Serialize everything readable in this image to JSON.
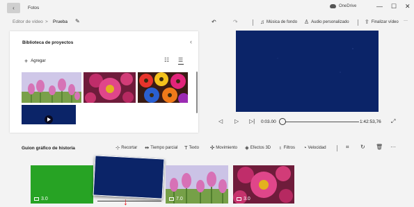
{
  "window": {
    "app_title": "Fotos",
    "back_icon": "back-arrow-icon",
    "onedrive_label": "OneDrive",
    "controls": [
      "—",
      "☐",
      "✕"
    ]
  },
  "breadcrumb": {
    "editor": "Editor de vídeo",
    "separator": ">",
    "project": "Prueba",
    "edit_icon": "pencil-icon"
  },
  "toolbar": {
    "undo": "↶",
    "redo": "↷",
    "background_music": "Música de fondo",
    "custom_audio": "Audio personalizado",
    "finish_video": "Finalizar vídeo",
    "more": "···"
  },
  "library": {
    "title": "Biblioteca de proyectos",
    "add_label": "Agregar",
    "thumbnails": [
      "tulips",
      "pink-gerbera",
      "colorful-gerberas",
      "blue-video"
    ]
  },
  "playback": {
    "current_time": "0:03.00",
    "total_time": "1:42:53,76",
    "progress": 0.0
  },
  "storyboard": {
    "title": "Guion gráfico de historia",
    "tools": {
      "crop": "Recortar",
      "split": "Tiempo parcial",
      "text": "Texto",
      "motion": "Movimiento",
      "effects3d": "Efectos 3D",
      "filters": "Filtros",
      "speed": "Velocidad"
    },
    "cards": [
      {
        "kind": "color",
        "duration": "3.0"
      },
      {
        "kind": "video",
        "duration": ""
      },
      {
        "kind": "tulips",
        "duration": "7.0"
      },
      {
        "kind": "pink-gerbera",
        "duration": "3.0"
      }
    ]
  },
  "colors": {
    "green_card": "#27a324",
    "video_blue": "#0b2468",
    "cursor": "#e8141b"
  }
}
